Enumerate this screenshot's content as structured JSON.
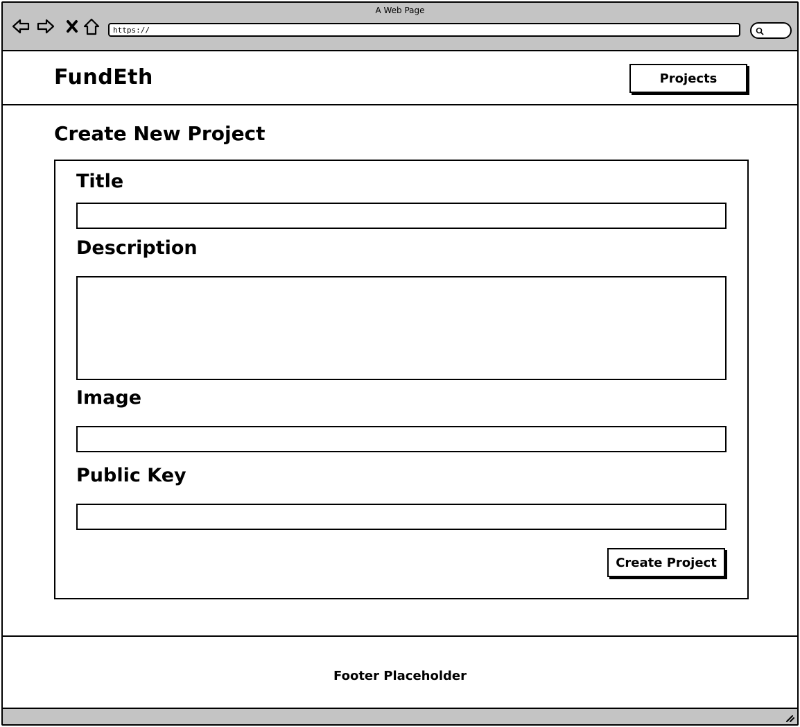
{
  "browser": {
    "window_title": "A Web Page",
    "url": "https://",
    "icons": [
      "back-arrow-icon",
      "forward-arrow-icon",
      "stop-icon",
      "home-icon",
      "search-icon",
      "resize-grip-icon"
    ]
  },
  "header": {
    "brand": "FundEth",
    "nav_button": "Projects"
  },
  "main": {
    "page_title": "Create New Project",
    "form": {
      "title_label": "Title",
      "title_value": "",
      "description_label": "Description",
      "description_value": "",
      "image_label": "Image",
      "image_value": "",
      "public_key_label": "Public Key",
      "public_key_value": "",
      "submit_label": "Create Project"
    }
  },
  "footer": {
    "text": "Footer Placeholder"
  }
}
